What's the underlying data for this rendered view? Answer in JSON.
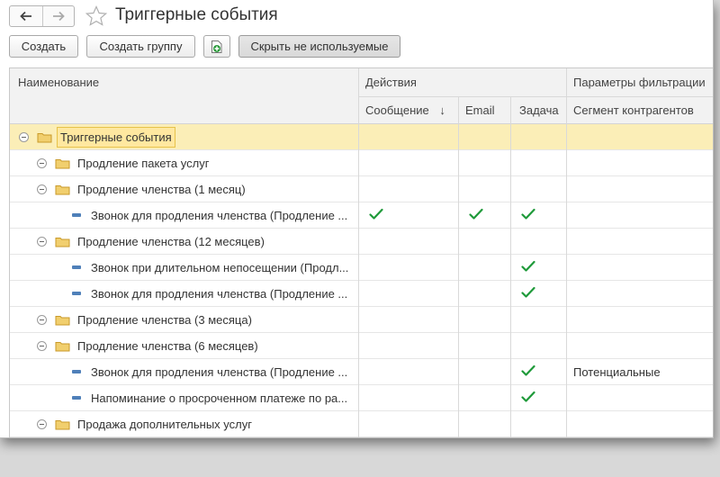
{
  "window": {
    "title": "Триггерные события"
  },
  "nav": {
    "back_icon": "arrow-left-icon",
    "forward_icon": "arrow-right-icon",
    "favorite_icon": "star-icon"
  },
  "toolbar": {
    "create_label": "Создать",
    "create_group_label": "Создать группу",
    "add_icon": "add-document-icon",
    "hide_unused_label": "Скрыть не используемые"
  },
  "columns": {
    "name": "Наименование",
    "actions": "Действия",
    "message": "Сообщение",
    "sort_arrow": "↓",
    "email": "Email",
    "task": "Задача",
    "filter_params": "Параметры фильтрации",
    "segment": "Сегмент контрагентов"
  },
  "colors": {
    "check": "#1f9a3a",
    "selection": "#fbeeb7",
    "folder": "#f1cf6e",
    "leaf": "#4f80b9"
  },
  "rows": [
    {
      "name": "Триггерные события",
      "type": "folder",
      "level": 0,
      "selected": true,
      "message": false,
      "email": false,
      "task": false,
      "segment": ""
    },
    {
      "name": "Продление пакета услуг",
      "type": "folder",
      "level": 1,
      "selected": false,
      "message": false,
      "email": false,
      "task": false,
      "segment": ""
    },
    {
      "name": "Продление членства (1 месяц)",
      "type": "folder",
      "level": 1,
      "selected": false,
      "message": false,
      "email": false,
      "task": false,
      "segment": ""
    },
    {
      "name": "Звонок для продления членства (Продление ...",
      "type": "item",
      "level": 2,
      "selected": false,
      "message": true,
      "email": true,
      "task": true,
      "segment": ""
    },
    {
      "name": "Продление членства (12 месяцев)",
      "type": "folder",
      "level": 1,
      "selected": false,
      "message": false,
      "email": false,
      "task": false,
      "segment": ""
    },
    {
      "name": "Звонок при длительном непосещении (Продл...",
      "type": "item",
      "level": 2,
      "selected": false,
      "message": false,
      "email": false,
      "task": true,
      "segment": ""
    },
    {
      "name": "Звонок для продления членства (Продление ...",
      "type": "item",
      "level": 2,
      "selected": false,
      "message": false,
      "email": false,
      "task": true,
      "segment": ""
    },
    {
      "name": "Продление членства (3 месяца)",
      "type": "folder",
      "level": 1,
      "selected": false,
      "message": false,
      "email": false,
      "task": false,
      "segment": ""
    },
    {
      "name": "Продление членства (6 месяцев)",
      "type": "folder",
      "level": 1,
      "selected": false,
      "message": false,
      "email": false,
      "task": false,
      "segment": ""
    },
    {
      "name": "Звонок для продления членства (Продление ...",
      "type": "item",
      "level": 2,
      "selected": false,
      "message": false,
      "email": false,
      "task": true,
      "segment": "Потенциальные"
    },
    {
      "name": "Напоминание о просроченном платеже по ра...",
      "type": "item",
      "level": 2,
      "selected": false,
      "message": false,
      "email": false,
      "task": true,
      "segment": ""
    },
    {
      "name": "Продажа дополнительных услуг",
      "type": "folder",
      "level": 1,
      "selected": false,
      "message": false,
      "email": false,
      "task": false,
      "segment": ""
    }
  ]
}
